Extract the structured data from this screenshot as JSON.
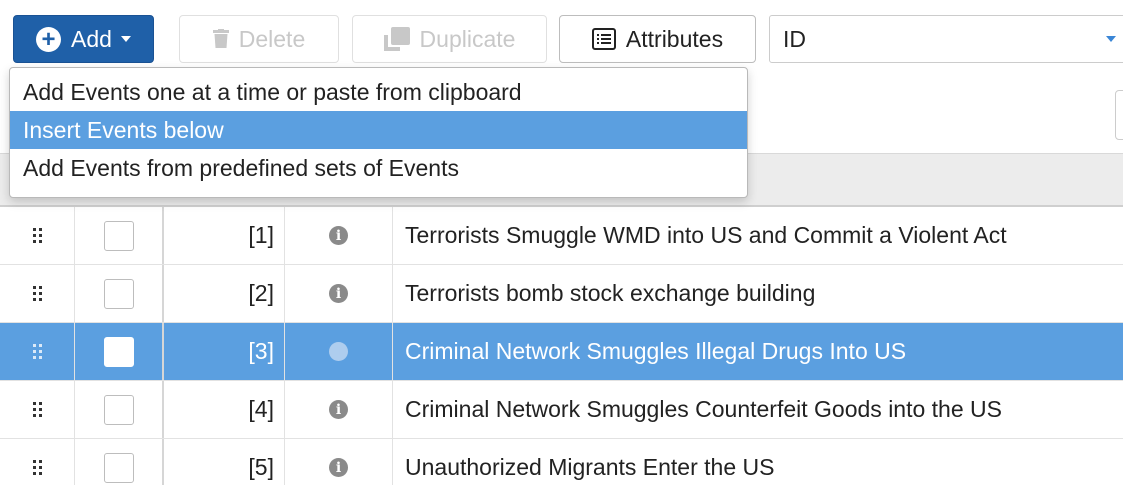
{
  "toolbar": {
    "add_label": "Add",
    "delete_label": "Delete",
    "duplicate_label": "Duplicate",
    "attributes_label": "Attributes",
    "sort_field_value": "ID"
  },
  "add_menu": {
    "items": [
      {
        "label": "Add Events one at a time or paste from clipboard",
        "active": false
      },
      {
        "label": "Insert Events below",
        "active": true
      },
      {
        "label": "Add Events from predefined sets of Events",
        "active": false
      }
    ]
  },
  "events": {
    "rows": [
      {
        "id": "[1]",
        "name": "Terrorists Smuggle WMD into US and Commit a Violent Act",
        "selected": false
      },
      {
        "id": "[2]",
        "name": "Terrorists bomb stock exchange building",
        "selected": false
      },
      {
        "id": "[3]",
        "name": "Criminal Network Smuggles Illegal Drugs Into US",
        "selected": true
      },
      {
        "id": "[4]",
        "name": "Criminal Network Smuggles Counterfeit Goods into the US",
        "selected": false
      },
      {
        "id": "[5]",
        "name": "Unauthorized Migrants Enter the US",
        "selected": false
      }
    ]
  },
  "icons": {
    "add": "plus-circle-icon",
    "add_caret": "caret-down-icon",
    "delete": "trash-icon",
    "duplicate": "copy-icon",
    "attributes": "list-icon",
    "drag": "drag-handle-icon",
    "info": "info-icon"
  },
  "colors": {
    "primary": "#1f60a8",
    "selection": "#5b9fe0",
    "disabled_text": "#c8c8c8",
    "header_bg": "#ececec"
  }
}
